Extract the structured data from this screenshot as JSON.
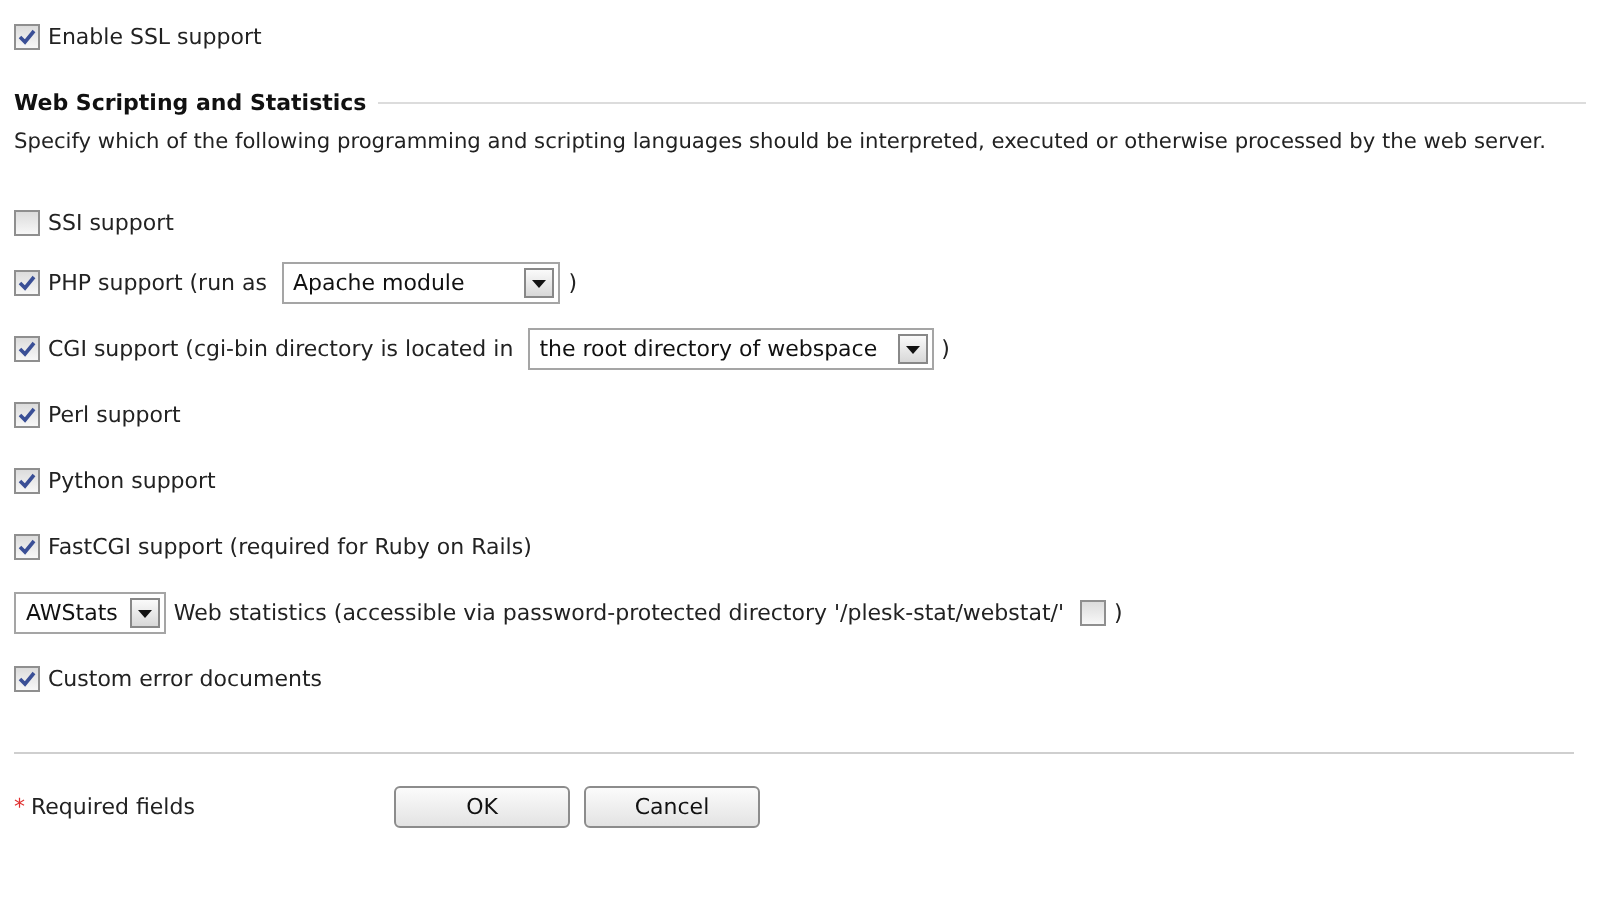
{
  "ssl": {
    "label": "Enable SSL support",
    "checked": true
  },
  "section": {
    "title": "Web Scripting and Statistics",
    "description": "Specify which of the following programming and scripting languages should be interpreted, executed or otherwise processed by the web server."
  },
  "options": [
    {
      "kind": "check",
      "label": "SSI support",
      "checked": false
    },
    {
      "kind": "check_select",
      "label": "PHP support (run as",
      "value": "Apache module",
      "suffix": ")",
      "checked": true
    },
    {
      "kind": "check_select",
      "label": "CGI support (cgi-bin directory is located in",
      "value": "the root directory of webspace",
      "suffix": ")",
      "checked": true
    },
    {
      "kind": "check",
      "label": "Perl support",
      "checked": true
    },
    {
      "kind": "check",
      "label": "Python support",
      "checked": true
    },
    {
      "kind": "check",
      "label": "FastCGI support (required for Ruby on Rails)",
      "checked": true
    },
    {
      "kind": "select_check",
      "value": "AWStats",
      "label": "Web statistics (accessible via password-protected directory '/plesk-stat/webstat/'",
      "suffix": ")",
      "checked": false
    },
    {
      "kind": "check",
      "label": "Custom error documents",
      "checked": true
    }
  ],
  "footer": {
    "required_mark": "*",
    "required_text": "Required fields",
    "buttons": [
      "OK",
      "Cancel"
    ]
  }
}
